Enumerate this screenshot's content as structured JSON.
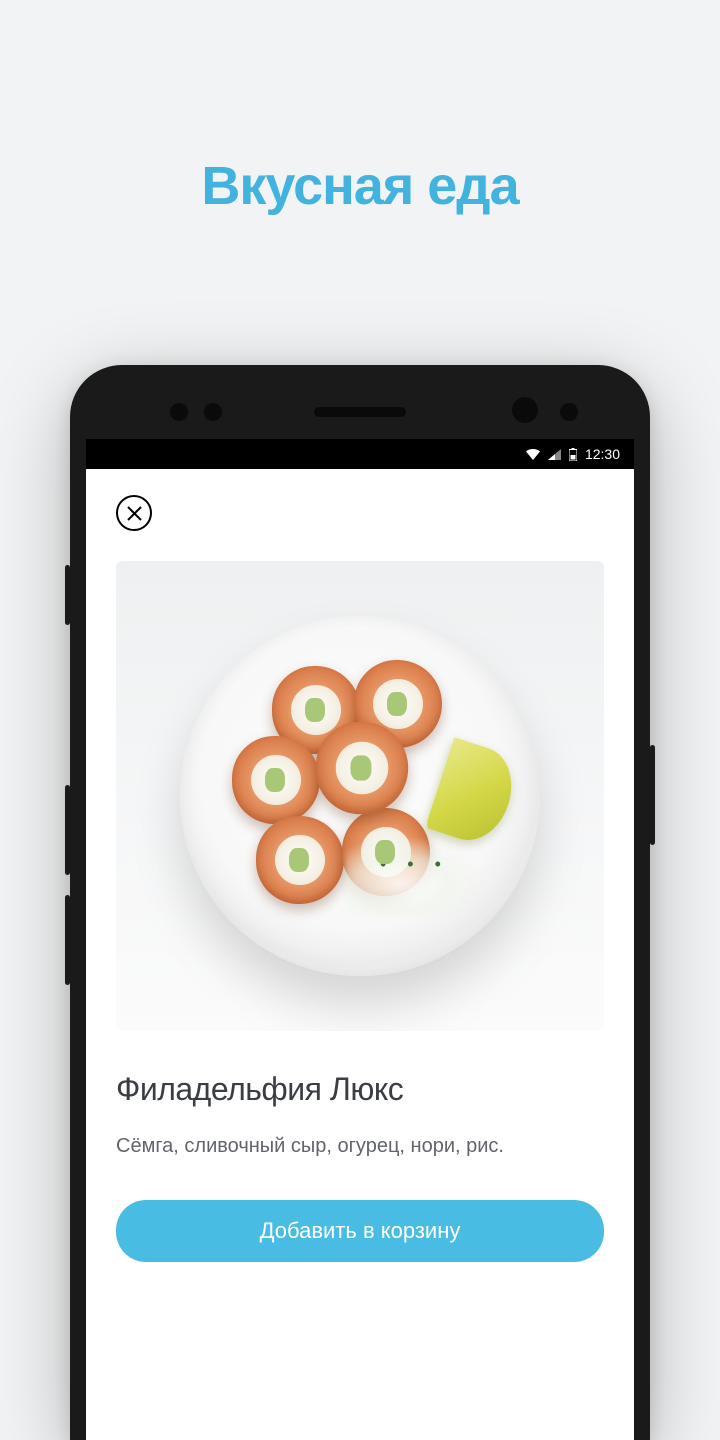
{
  "page": {
    "title": "Вкусная еда"
  },
  "statusBar": {
    "time": "12:30"
  },
  "product": {
    "title": "Филадельфия Люкс",
    "description": "Сёмга, сливочный сыр, огурец, нори, рис.",
    "addToCartLabel": "Добавить в корзину"
  }
}
